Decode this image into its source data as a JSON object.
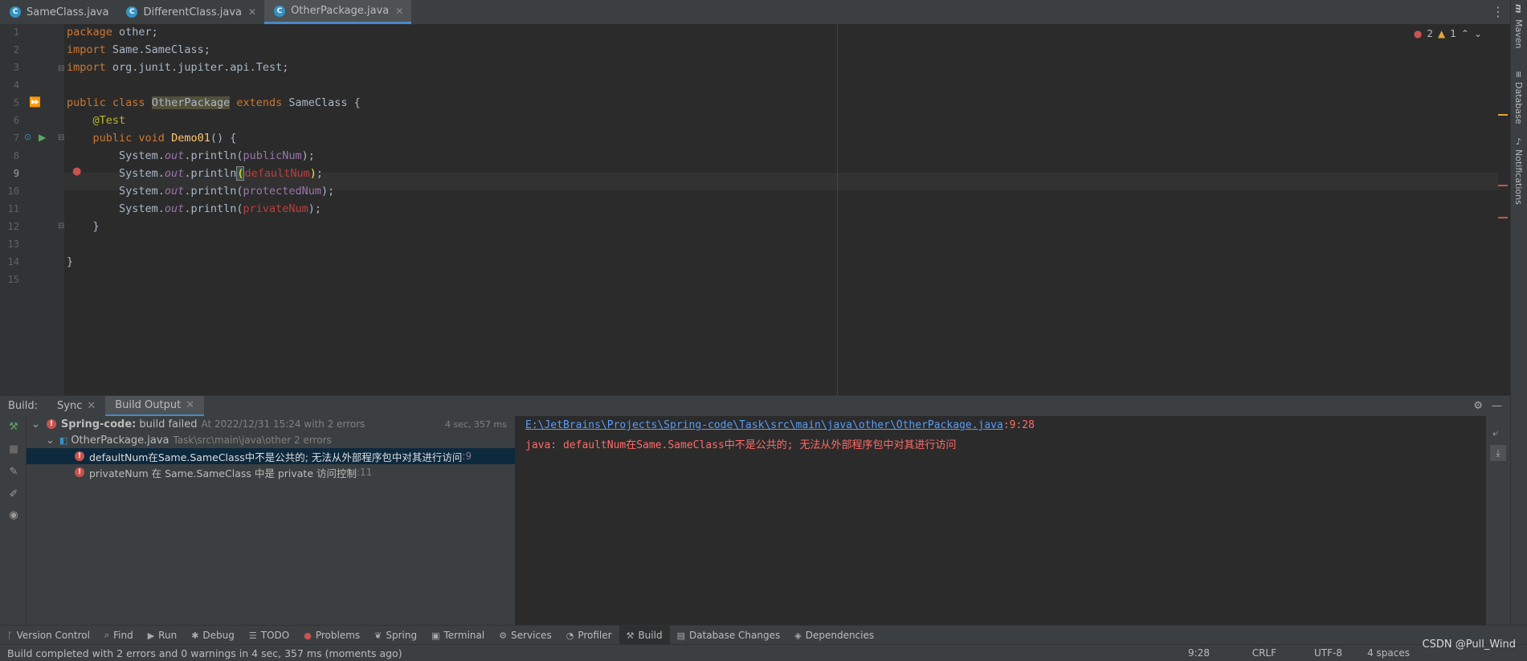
{
  "tabs": [
    {
      "label": "SameClass.java",
      "active": false
    },
    {
      "label": "DifferentClass.java",
      "active": false
    },
    {
      "label": "OtherPackage.java",
      "active": true
    }
  ],
  "editor": {
    "line_numbers": [
      "1",
      "2",
      "3",
      "4",
      "5",
      "6",
      "7",
      "8",
      "9",
      "10",
      "11",
      "12",
      "13",
      "14",
      "15"
    ],
    "error_count": "2",
    "warning_count": "1"
  },
  "right_tools": [
    "Maven",
    "Database",
    "Notifications"
  ],
  "build_panel": {
    "title": "Build:",
    "tabs": [
      "Sync",
      "Build Output"
    ],
    "tree": {
      "root_name": "Spring-code:",
      "root_status": "build failed",
      "root_time": "At 2022/12/31 15:24 with 2 errors",
      "root_duration": "4 sec, 357 ms",
      "file_name": "OtherPackage.java",
      "file_path": "Task\\src\\main\\java\\other 2 errors",
      "errors": [
        {
          "msg": "defaultNum在Same.SameClass中不是公共的; 无法从外部程序包中对其进行访问",
          "loc": ":9"
        },
        {
          "msg": "privateNum 在 Same.SameClass 中是 private 访问控制",
          "loc": ":11"
        }
      ]
    },
    "console": {
      "link": "E:\\JetBrains\\Projects\\Spring-code\\Task\\src\\main\\java\\other\\OtherPackage.java",
      "pos": ":9:28",
      "message": "java: defaultNum在Same.SameClass中不是公共的; 无法从外部程序包中对其进行访问"
    }
  },
  "bottom_tabs": [
    "Version Control",
    "Find",
    "Run",
    "Debug",
    "TODO",
    "Problems",
    "Spring",
    "Terminal",
    "Services",
    "Profiler",
    "Build",
    "Database Changes",
    "Dependencies"
  ],
  "status": {
    "message": "Build completed with 2 errors and 0 warnings in 4 sec, 357 ms (moments ago)",
    "position": "9:28",
    "line_sep": "CRLF",
    "encoding": "UTF-8",
    "indent": "4 spaces",
    "watermark": "CSDN @Pull_Wind"
  }
}
